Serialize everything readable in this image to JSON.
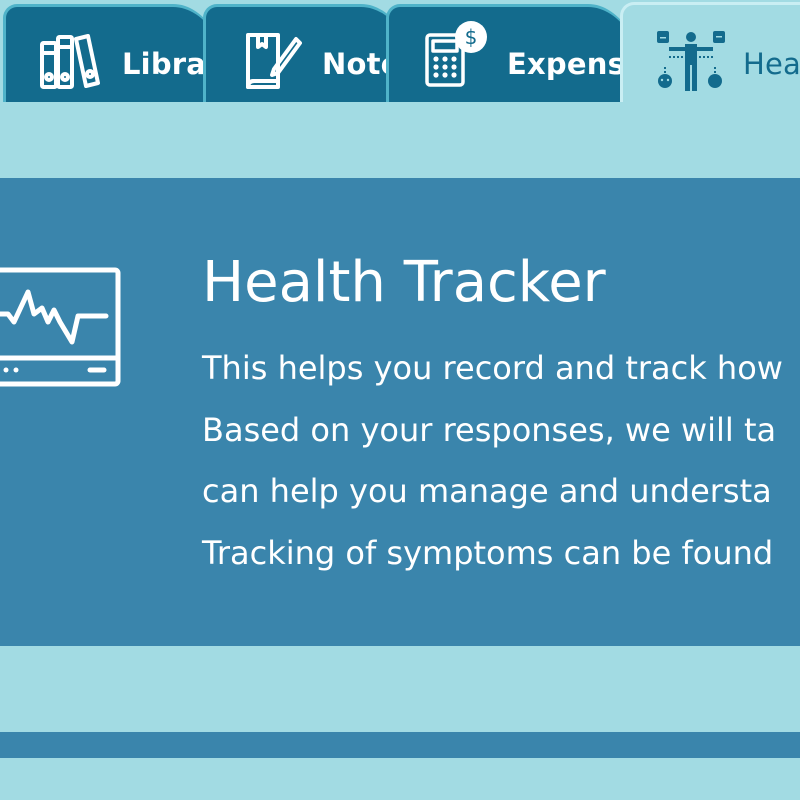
{
  "tabs": {
    "library": {
      "label": "Library",
      "icon": "books-icon"
    },
    "notes": {
      "label": "Notes",
      "icon": "notebook-pencil-icon"
    },
    "expenses": {
      "label": "Expenses",
      "icon": "calculator-dollar-icon"
    },
    "health": {
      "label": "Health",
      "icon": "body-symptoms-icon",
      "active": true
    }
  },
  "hero": {
    "title": "Health Tracker",
    "body_lines": [
      "This helps you record and track how",
      "Based on your responses, we will ta",
      "can help you manage and understa",
      "Tracking of symptoms can be found"
    ],
    "icon": "heart-monitor-icon"
  },
  "colors": {
    "tab_dark": "#136b8d",
    "tab_border": "#4fb3c9",
    "background": "#a2dbe3",
    "panel": "#3a85ac",
    "text_light": "#ffffff"
  }
}
